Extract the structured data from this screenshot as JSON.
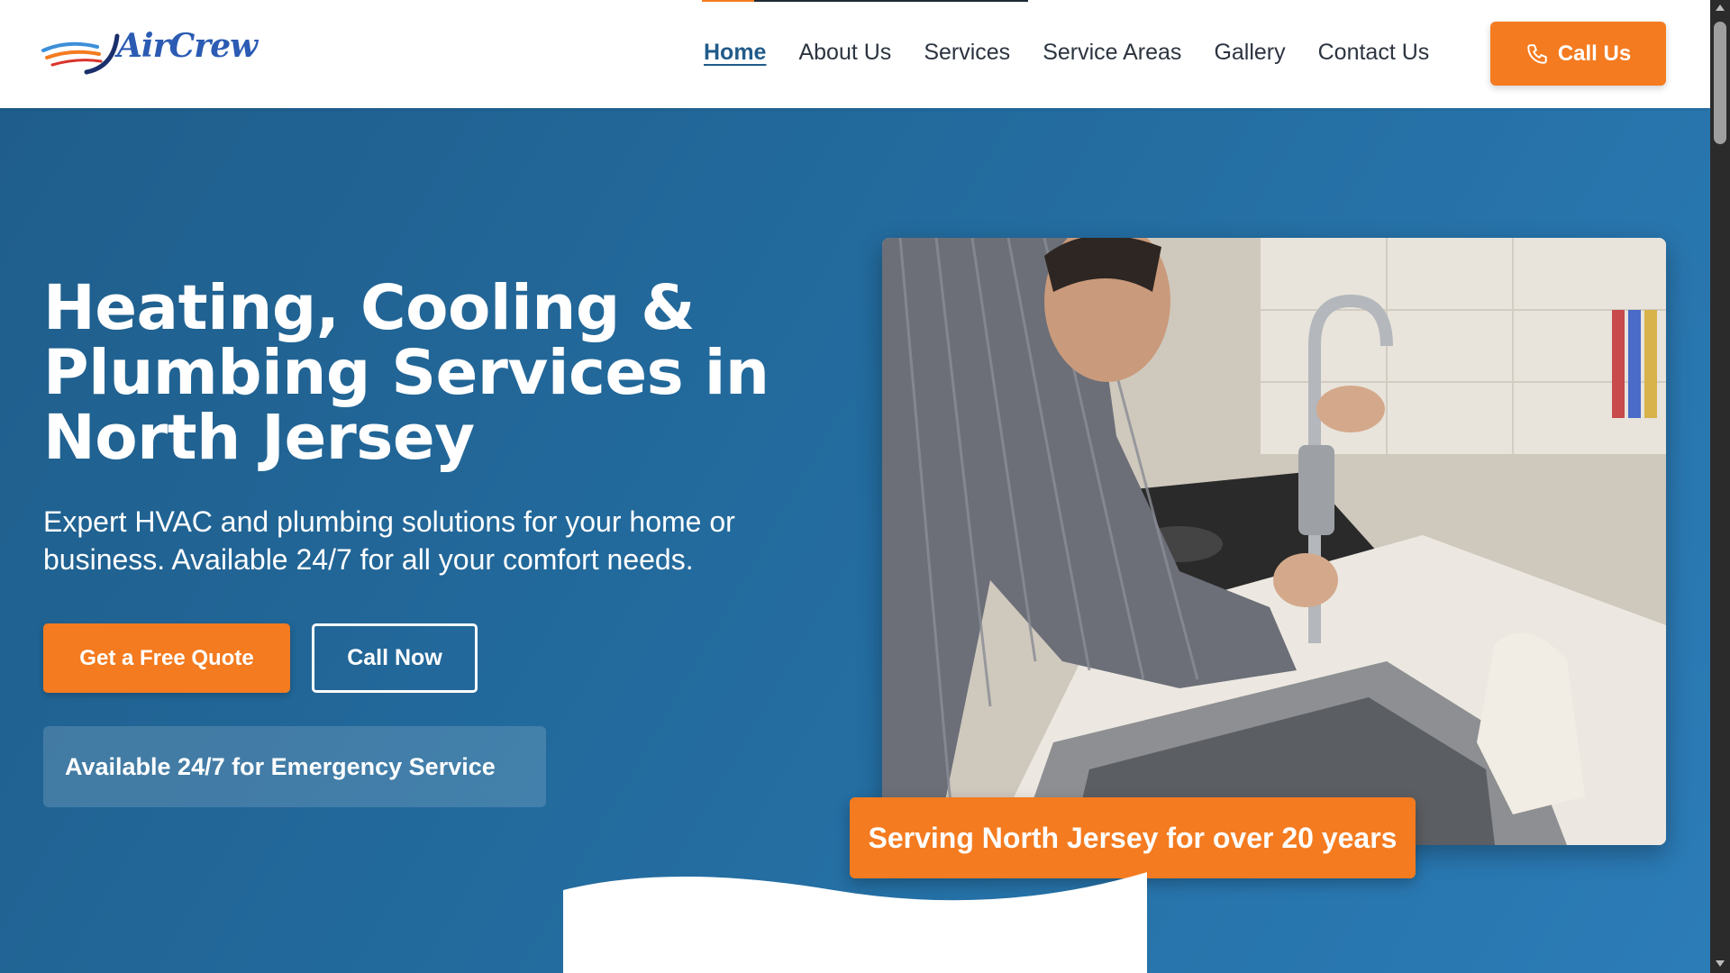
{
  "brand": {
    "logo_text": "AirCrew",
    "logo_icon": "swoosh-logo",
    "colors": {
      "primary": "#246ea2",
      "accent": "#f47b20",
      "dark": "#1f2a36"
    }
  },
  "header": {
    "scroll_progress": 0.16,
    "nav": [
      {
        "label": "Home",
        "active": true
      },
      {
        "label": "About Us",
        "active": false
      },
      {
        "label": "Services",
        "active": false
      },
      {
        "label": "Service Areas",
        "active": false
      },
      {
        "label": "Gallery",
        "active": false
      },
      {
        "label": "Contact Us",
        "active": false
      }
    ],
    "call_button": {
      "label": "Call Us",
      "icon": "phone-icon"
    }
  },
  "hero": {
    "title": "Heating, Cooling & Plumbing Services in North Jersey",
    "subtitle": "Expert HVAC and plumbing solutions for your home or business. Available 24/7 for all your comfort needs.",
    "primary_cta": "Get a Free Quote",
    "secondary_cta": "Call Now",
    "emergency_note": "Available 24/7 for Emergency Service",
    "badge": "Serving North Jersey for over 20 years"
  }
}
